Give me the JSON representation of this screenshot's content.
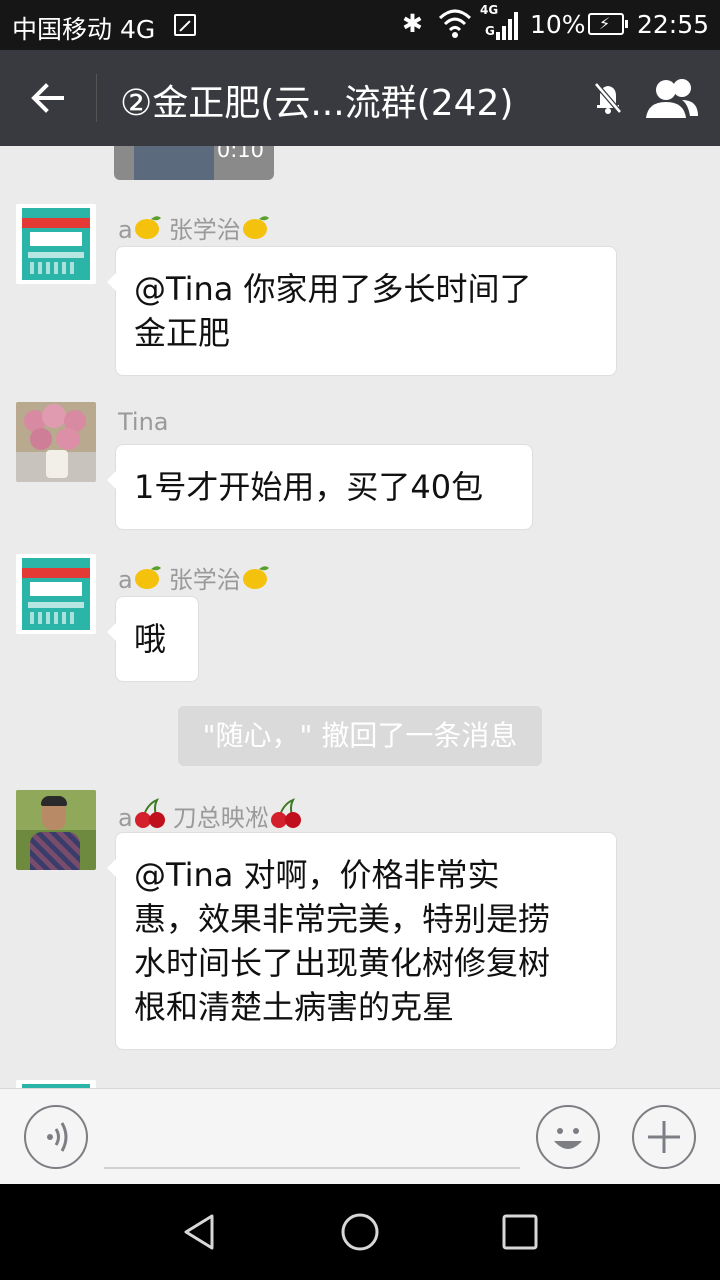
{
  "status_bar": {
    "carrier": "中国移动 4G",
    "network_badge_top": "4G",
    "network_badge_bottom": "G",
    "battery": "10%",
    "time": "22:55"
  },
  "header": {
    "title": "②金正肥(云...流群(242)",
    "icons": [
      "back-arrow-icon",
      "mute-bell-icon",
      "group-members-icon"
    ]
  },
  "chat": {
    "video": {
      "duration": "0:10"
    },
    "messages": [
      {
        "prefix": "a",
        "name": "张学治",
        "emoji": "lemon",
        "text": "@Tina 你家用了多长时间了金正肥",
        "line1": "@Tina 你家用了多长时间了",
        "line2": "金正肥"
      },
      {
        "prefix": "",
        "name": "Tina",
        "emoji": "",
        "text": "1号才开始用，买了40包"
      },
      {
        "prefix": "a",
        "name": "张学治",
        "emoji": "lemon",
        "text": "哦"
      },
      {
        "prefix": "a",
        "name": "刀总映凇",
        "emoji": "cherry",
        "line1": "@Tina 对啊，价格非常实",
        "line2": "惠，效果非常完美，特别是捞",
        "line3": "水时间长了出现黄化树修复树",
        "line4": "根和清楚土病害的克星"
      }
    ],
    "recall_notice": "\"随心，\" 撤回了一条消息"
  },
  "input_bar": {
    "icons": [
      "voice-input-icon",
      "emoji-icon",
      "more-plus-icon"
    ]
  },
  "nav_bar": {
    "icons": [
      "back-triangle-icon",
      "home-circle-icon",
      "recents-square-icon"
    ]
  },
  "colors": {
    "title_bar": "#393a3f",
    "status_bar": "#161616",
    "chat_bg": "#ebebeb",
    "bubble": "#ffffff"
  }
}
